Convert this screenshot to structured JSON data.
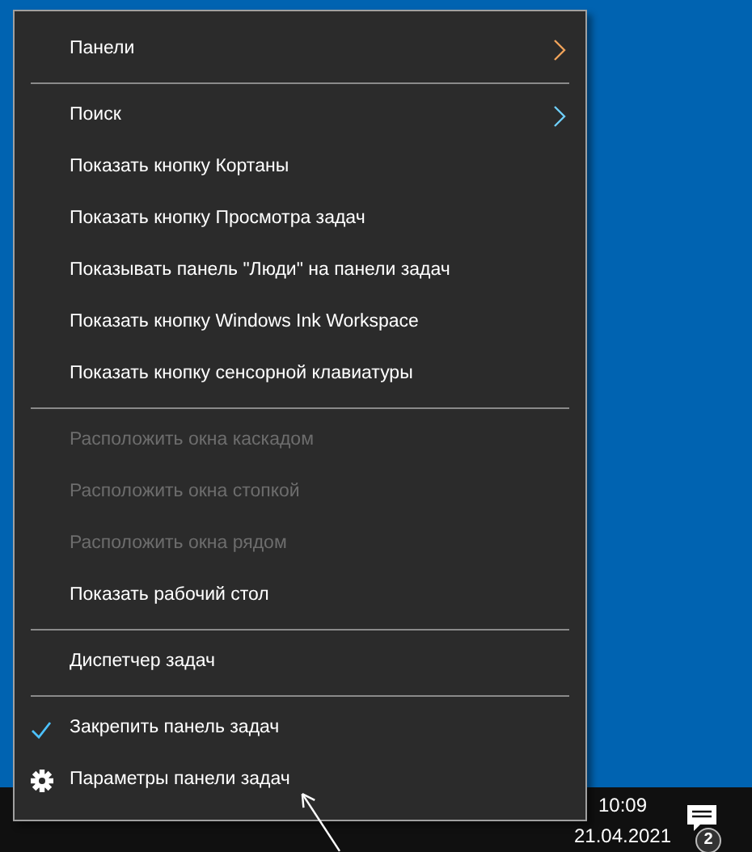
{
  "menu": {
    "items": [
      {
        "kind": "item",
        "label": "Панели",
        "submenu": true,
        "disabled": false,
        "checked": false
      },
      {
        "kind": "separator"
      },
      {
        "kind": "item",
        "label": "Поиск",
        "submenu": true,
        "disabled": false,
        "checked": false
      },
      {
        "kind": "item",
        "label": "Показать кнопку Кортаны",
        "submenu": false,
        "disabled": false,
        "checked": false
      },
      {
        "kind": "item",
        "label": "Показать кнопку Просмотра задач",
        "submenu": false,
        "disabled": false,
        "checked": false
      },
      {
        "kind": "item",
        "label": "Показывать панель \"Люди\" на панели задач",
        "submenu": false,
        "disabled": false,
        "checked": false
      },
      {
        "kind": "item",
        "label": "Показать кнопку Windows Ink Workspace",
        "submenu": false,
        "disabled": false,
        "checked": false
      },
      {
        "kind": "item",
        "label": "Показать кнопку сенсорной клавиатуры",
        "submenu": false,
        "disabled": false,
        "checked": false
      },
      {
        "kind": "separator"
      },
      {
        "kind": "item",
        "label": "Расположить окна каскадом",
        "submenu": false,
        "disabled": true,
        "checked": false
      },
      {
        "kind": "item",
        "label": "Расположить окна стопкой",
        "submenu": false,
        "disabled": true,
        "checked": false
      },
      {
        "kind": "item",
        "label": "Расположить окна рядом",
        "submenu": false,
        "disabled": true,
        "checked": false
      },
      {
        "kind": "item",
        "label": "Показать рабочий стол",
        "submenu": false,
        "disabled": false,
        "checked": false
      },
      {
        "kind": "separator"
      },
      {
        "kind": "item",
        "label": "Диспетчер задач",
        "submenu": false,
        "disabled": false,
        "checked": false
      },
      {
        "kind": "separator"
      },
      {
        "kind": "item",
        "label": "Закрепить панель задач",
        "submenu": false,
        "disabled": false,
        "checked": true
      },
      {
        "kind": "settings",
        "label": "Параметры панели задач",
        "submenu": false,
        "disabled": false,
        "checked": false
      }
    ]
  },
  "taskbar": {
    "time": "10:09",
    "date": "21.04.2021",
    "notification_count": "2"
  }
}
